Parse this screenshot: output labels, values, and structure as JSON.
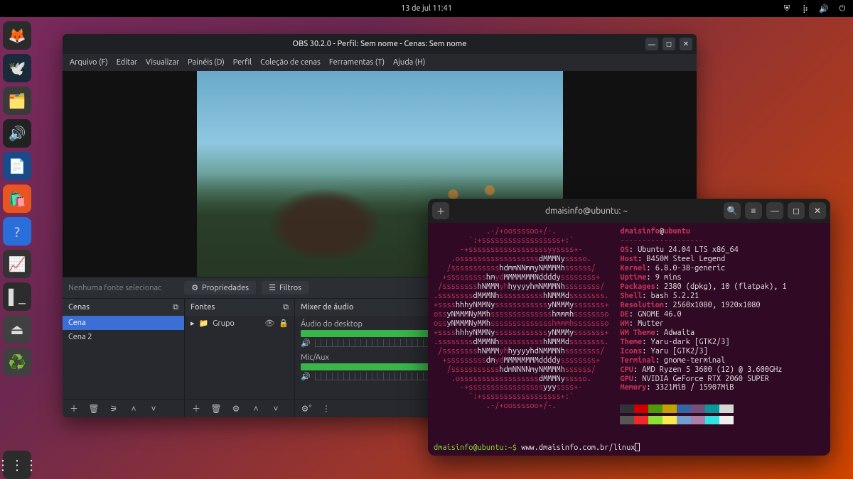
{
  "topbar": {
    "clock": "13 de jul  11:41"
  },
  "dock": {
    "items": [
      "firefox",
      "thunderbird",
      "files",
      "rhythmbox",
      "libreoffice",
      "software",
      "help",
      "monitor",
      "terminal",
      "usb",
      "trash",
      "show-apps"
    ]
  },
  "obs": {
    "title": "OBS 30.2.0 - Perfil: Sem nome - Cenas: Sem nome",
    "menu": {
      "arquivo": "Arquivo (F)",
      "editar": "Editar",
      "visualizar": "Visualizar",
      "paineis": "Painéis (D)",
      "perfil": "Perfil",
      "colecao": "Coleção de cenas",
      "ferramentas": "Ferramentas (T)",
      "ajuda": "Ajuda (H)"
    },
    "toolbar": {
      "no_source": "Nenhuma fonte selecionac",
      "propriedades": "Propriedades",
      "filtros": "Filtros"
    },
    "panels": {
      "cenas": {
        "title": "Cenas",
        "items": [
          {
            "label": "Cena",
            "selected": true
          },
          {
            "label": "Cena 2",
            "selected": false
          }
        ]
      },
      "fontes": {
        "title": "Fontes",
        "items": [
          {
            "label": "Grupo"
          }
        ]
      },
      "mixer": {
        "title": "Mixer de áudio",
        "tracks": [
          {
            "name": "Áudio do desktop",
            "fill": 0.75,
            "knob": 0.82
          },
          {
            "name": "Mic/Aux",
            "fill": 0.7,
            "knob": 0.82
          }
        ]
      }
    }
  },
  "terminal": {
    "title": "dmaisinfo@ubuntu: ~",
    "user": "dmaisinfo",
    "host": "ubuntu",
    "neofetch": [
      {
        "k": "OS",
        "v": "Ubuntu 24.04 LTS x86_64"
      },
      {
        "k": "Host",
        "v": "B450M Steel Legend"
      },
      {
        "k": "Kernel",
        "v": "6.8.0-38-generic"
      },
      {
        "k": "Uptime",
        "v": "9 mins"
      },
      {
        "k": "Packages",
        "v": "2380 (dpkg), 10 (flatpak), 1"
      },
      {
        "k": "Shell",
        "v": "bash 5.2.21"
      },
      {
        "k": "Resolution",
        "v": "2560x1080, 1920x1080"
      },
      {
        "k": "DE",
        "v": "GNOME 46.0"
      },
      {
        "k": "WM",
        "v": "Mutter"
      },
      {
        "k": "WM Theme",
        "v": "Adwaita"
      },
      {
        "k": "Theme",
        "v": "Yaru-dark [GTK2/3]"
      },
      {
        "k": "Icons",
        "v": "Yaru [GTK2/3]"
      },
      {
        "k": "Terminal",
        "v": "gnome-terminal"
      },
      {
        "k": "CPU",
        "v": "AMD Ryzen 5 3600 (12) @ 3.600GHz"
      },
      {
        "k": "GPU",
        "v": "NVIDIA GeForce RTX 2060 SUPER"
      },
      {
        "k": "Memory",
        "v": "3321MiB / 15907MiB"
      }
    ],
    "swatches": [
      "#2e3436",
      "#cc0000",
      "#4e9a06",
      "#c4a000",
      "#3465a4",
      "#75507b",
      "#06989a",
      "#d3d7cf",
      "#555753",
      "#ef2929",
      "#8ae234",
      "#fce94f",
      "#729fcf",
      "#ad7fa8",
      "#34e2e2",
      "#eeeeec"
    ],
    "prompt": {
      "user_host": "dmaisinfo@ubuntu",
      "path": "~",
      "command": "www.dmaisinfo.com.br/linux"
    }
  }
}
